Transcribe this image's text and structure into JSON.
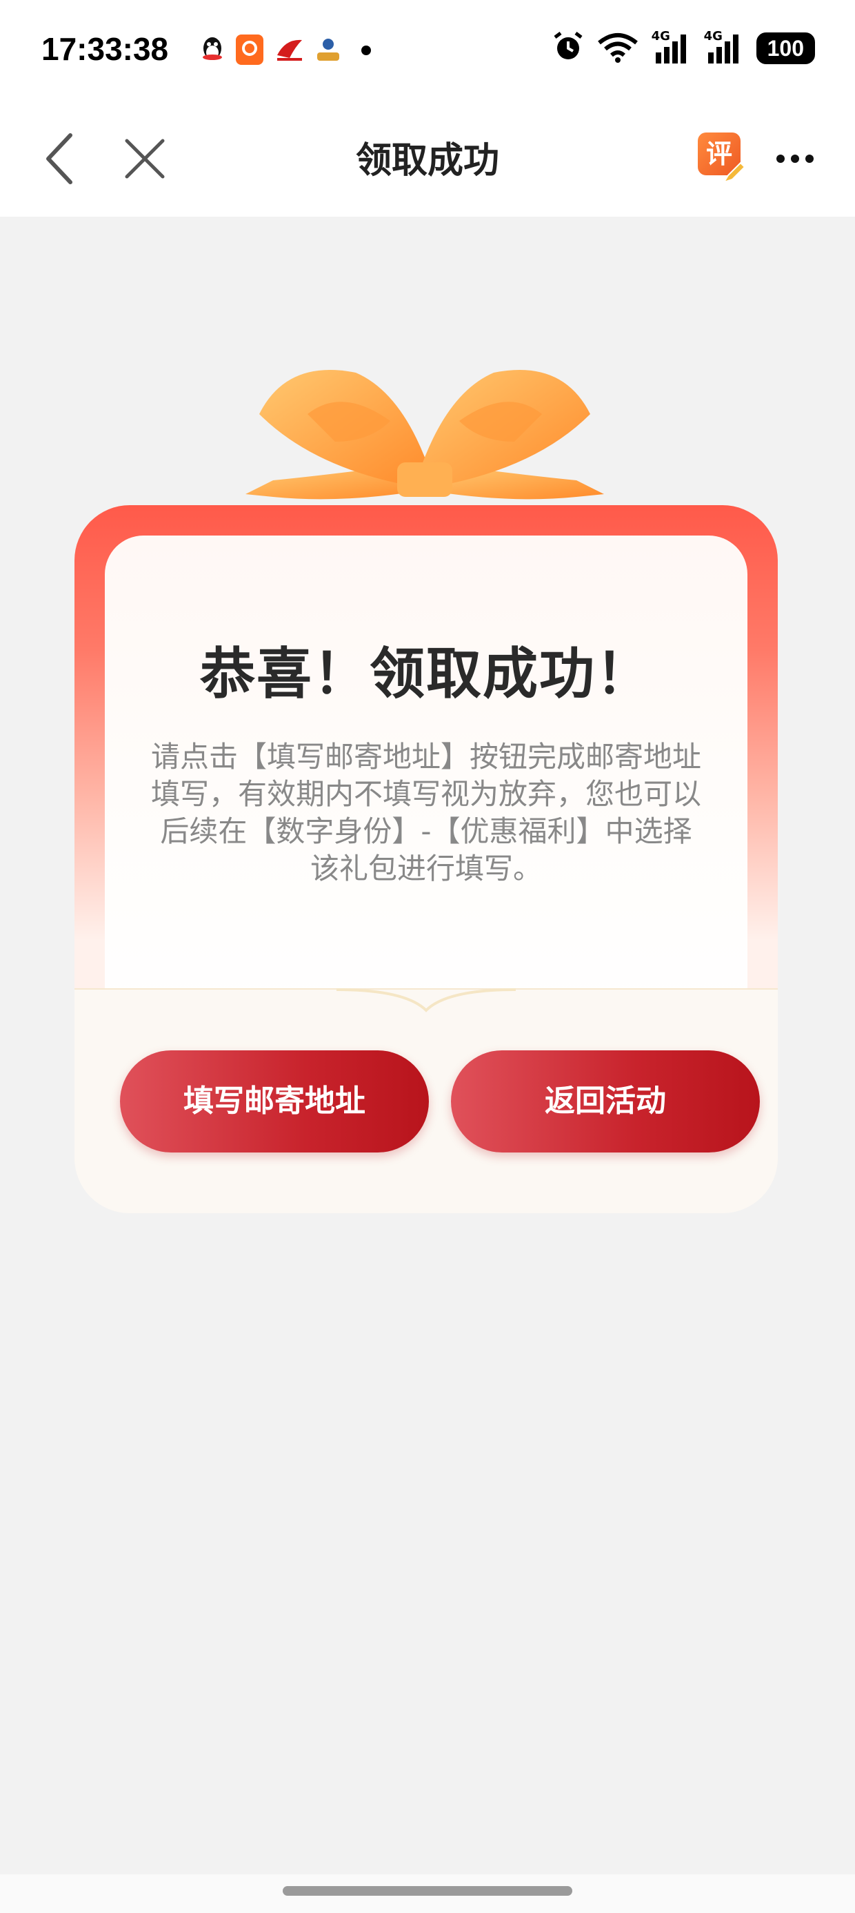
{
  "status_bar": {
    "time": "17:33:38",
    "signal_1": "4G",
    "signal_2": "4G",
    "battery": "100"
  },
  "nav": {
    "title": "领取成功",
    "rate_badge": "评"
  },
  "card": {
    "title": "恭喜！领取成功！",
    "description": "请点击【填写邮寄地址】按钮完成邮寄地址填写，有效期内不填写视为放弃，您也可以后续在【数字身份】-【优惠福利】中选择该礼包进行填写。",
    "fill_address_button": "填写邮寄地址",
    "back_button": "返回活动"
  },
  "colors": {
    "primary_red": "#c8232c",
    "ribbon_orange": "#ff9a3c",
    "page_bg": "#f2f2f2"
  }
}
